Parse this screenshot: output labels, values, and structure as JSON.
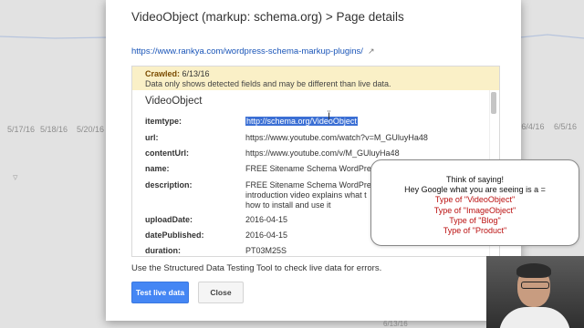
{
  "background": {
    "x_dates": [
      "5/17/16",
      "5/18/16",
      "5/20/16"
    ],
    "right_dates": [
      "6/4/16",
      "6/5/16"
    ],
    "bottom_label": "6/13/16"
  },
  "dialog": {
    "title": "VideoObject (markup: schema.org) > Page details",
    "url": "https://www.rankya.com/wordpress-schema-markup-plugins/",
    "crawled_label": "Crawled:",
    "crawled_date": "6/13/16",
    "crawled_note": "Data only shows detected fields and may be different than live data.",
    "section_title": "VideoObject",
    "fields": [
      {
        "key": "itemtype:",
        "value": "http://schema.org/VideoObject"
      },
      {
        "key": "url:",
        "value": "https://www.youtube.com/watch?v=M_GUluyHa48"
      },
      {
        "key": "contentUrl:",
        "value": "https://www.youtube.com/v/M_GUluyHa48"
      },
      {
        "key": "name:",
        "value": "FREE Sitename Schema WordPre"
      },
      {
        "key": "description:",
        "value": "FREE Sitename Schema WordPre introduction video explains what t how to install and use it"
      },
      {
        "key": "uploadDate:",
        "value": "2016-04-15"
      },
      {
        "key": "datePublished:",
        "value": "2016-04-15"
      },
      {
        "key": "duration:",
        "value": "PT03M25S"
      }
    ],
    "footer_text": "Use the Structured Data Testing Tool to check live data for errors.",
    "test_button": "Test live data",
    "close_button": "Close"
  },
  "annotation": {
    "line1": "Think of saying!",
    "line2": "Hey Google what you are seeing is a =",
    "types": [
      "Type of \"VideoObject\"",
      "Type of \"ImageObject\"",
      "Type of \"Blog\"",
      "Type of \"Product\""
    ]
  },
  "colors": {
    "link": "#1a55b8",
    "banner": "#faf0c7",
    "primary_button": "#4486f4",
    "annotation_red": "#bb1111"
  }
}
